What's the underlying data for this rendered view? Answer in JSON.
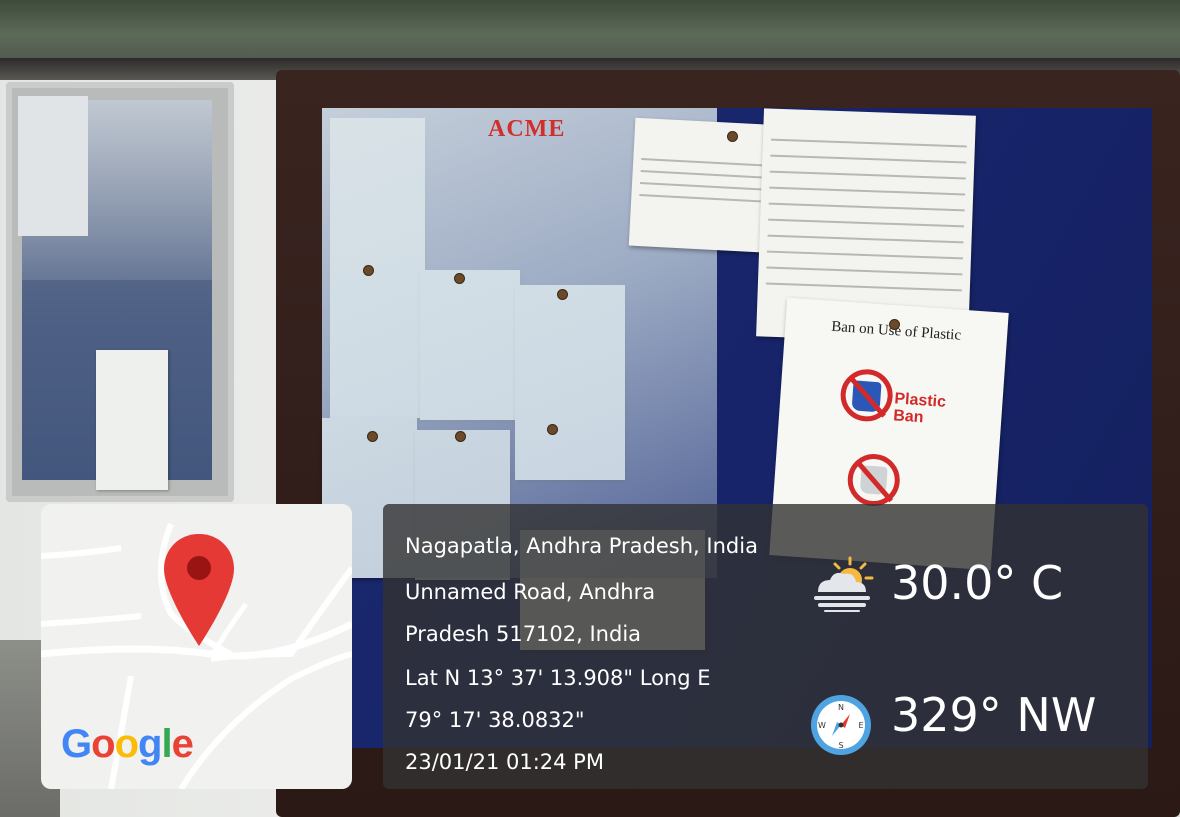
{
  "scene": {
    "board_header": "ACME",
    "poster_title": "Ban on Use of Plastic",
    "poster_ban_line1": "Plastic",
    "poster_ban_line2": "Ban"
  },
  "map": {
    "logo_letters": [
      {
        "char": "G",
        "color": "#4285F4"
      },
      {
        "char": "o",
        "color": "#EA4335"
      },
      {
        "char": "o",
        "color": "#FBBC05"
      },
      {
        "char": "g",
        "color": "#4285F4"
      },
      {
        "char": "l",
        "color": "#34A853"
      },
      {
        "char": "e",
        "color": "#EA4335"
      }
    ],
    "pin_color": "#E53935",
    "pin_icon": "map-pin-icon"
  },
  "info": {
    "lines": [
      "Nagapatla, Andhra Pradesh, India",
      "Unnamed Road, Andhra",
      "Pradesh 517102, India",
      "Lat N 13° 37' 13.908\" Long E",
      "79° 17' 38.0832\"",
      "23/01/21 01:24 PM"
    ],
    "temperature": "30.0° C",
    "heading": "329° NW",
    "weather_icon": "partly-cloudy-icon",
    "compass_icon": "compass-icon"
  }
}
